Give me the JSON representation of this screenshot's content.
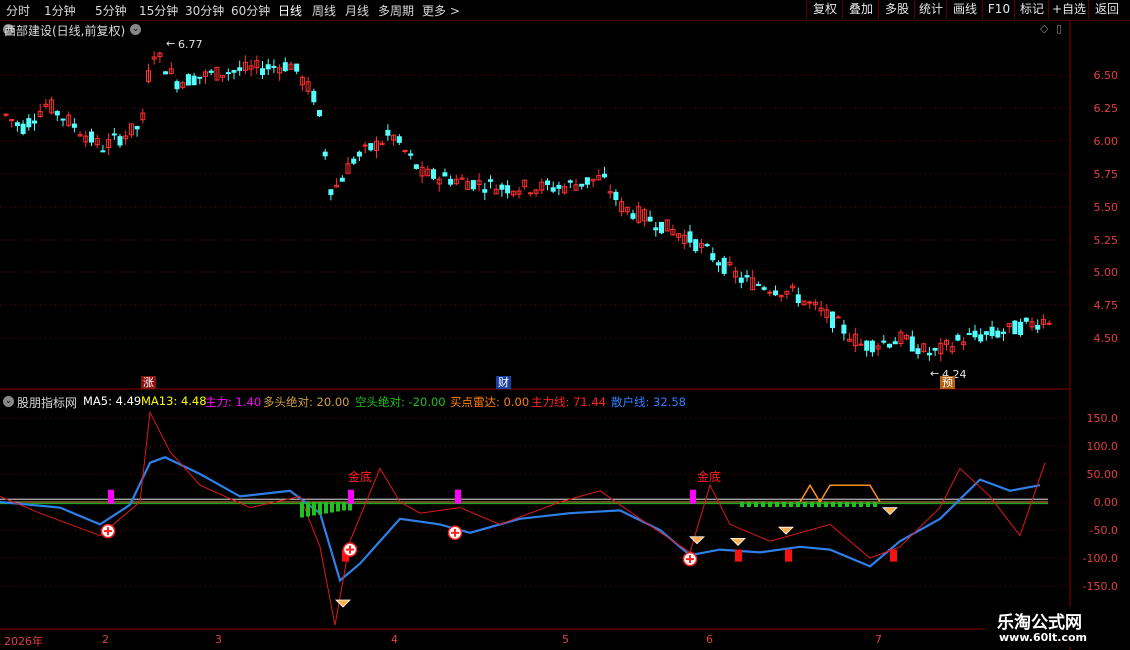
{
  "toolbar": {
    "periods": [
      "分时",
      "1分钟",
      "5分钟",
      "15分钟",
      "30分钟",
      "60分钟",
      "日线",
      "周线",
      "月线",
      "多周期",
      "更多 >"
    ],
    "active_period": "日线",
    "buttons": [
      "复权",
      "叠加",
      "多股",
      "统计",
      "画线",
      "F10",
      "标记",
      "+自选",
      "返回"
    ]
  },
  "main_chart": {
    "title": "西部建设(日线,前复权)",
    "high_annotation": "6.77",
    "low_annotation": "4.24",
    "y_ticks": [
      "6.50",
      "6.25",
      "6.00",
      "5.75",
      "5.50",
      "5.25",
      "5.00",
      "4.75",
      "4.50"
    ],
    "markers": {
      "zhang": "涨",
      "cai": "财",
      "yu": "预"
    }
  },
  "indicator": {
    "name": "股朋指标网",
    "legend": [
      {
        "label": "MA5: 4.49",
        "color": "#ffffff"
      },
      {
        "label": "MA13: 4.48",
        "color": "#ffff00"
      },
      {
        "label": "主力: 1.40",
        "color": "#ff00ff"
      },
      {
        "label": "多头绝对: 20.00",
        "color": "#d0a040"
      },
      {
        "label": "空头绝对: -20.00",
        "color": "#20c020"
      },
      {
        "label": "买点雷达: 0.00",
        "color": "#ff8000"
      },
      {
        "label": "主力线: 71.44",
        "color": "#ff2020"
      },
      {
        "label": "散户线: 32.58",
        "color": "#3080ff"
      }
    ],
    "y_ticks": [
      "150.0",
      "100.0",
      "50.00",
      "0.00",
      "-50.0",
      "-100.0",
      "-150.0"
    ],
    "annotations": {
      "jindi1": "金底",
      "jindi2": "金底"
    }
  },
  "date_axis": [
    "2026年",
    "2",
    "3",
    "4",
    "5",
    "6",
    "7"
  ],
  "watermark": {
    "line1": "乐淘公式网",
    "line2": "www.60lt.com"
  }
}
